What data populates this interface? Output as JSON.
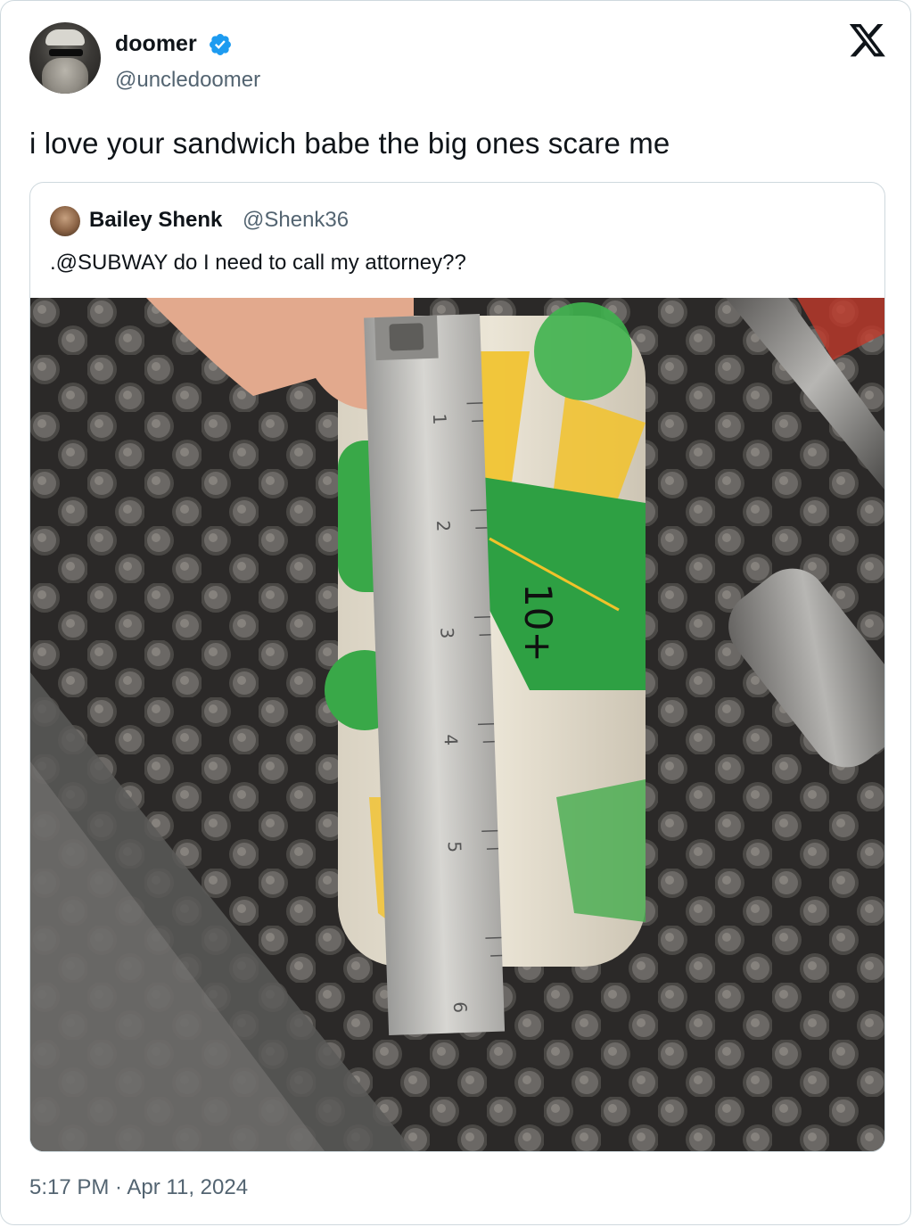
{
  "author": {
    "display_name": "doomer",
    "handle": "@uncledoomer",
    "verified_icon": "verified-badge-icon",
    "avatar_icon": "avatar-photo"
  },
  "brand_icon": "x-logo-icon",
  "tweet": {
    "text": "i love your sandwich babe the big ones scare me",
    "timestamp": "5:17 PM · Apr 11, 2024"
  },
  "quoted": {
    "display_name": "Bailey Shenk",
    "handle": "@Shenk36",
    "text": ".@SUBWAY do I need to call my attorney??",
    "photo": {
      "ruler_numbers": [
        "1",
        "2",
        "3",
        "4",
        "5",
        "6"
      ],
      "handwriting": "10+"
    }
  },
  "colors": {
    "text": "#0f1419",
    "secondary": "#536471",
    "border": "#cfd9de",
    "verified": "#1d9bf0",
    "subway_green": "#2ea043",
    "subway_yellow": "#f2c22a"
  }
}
